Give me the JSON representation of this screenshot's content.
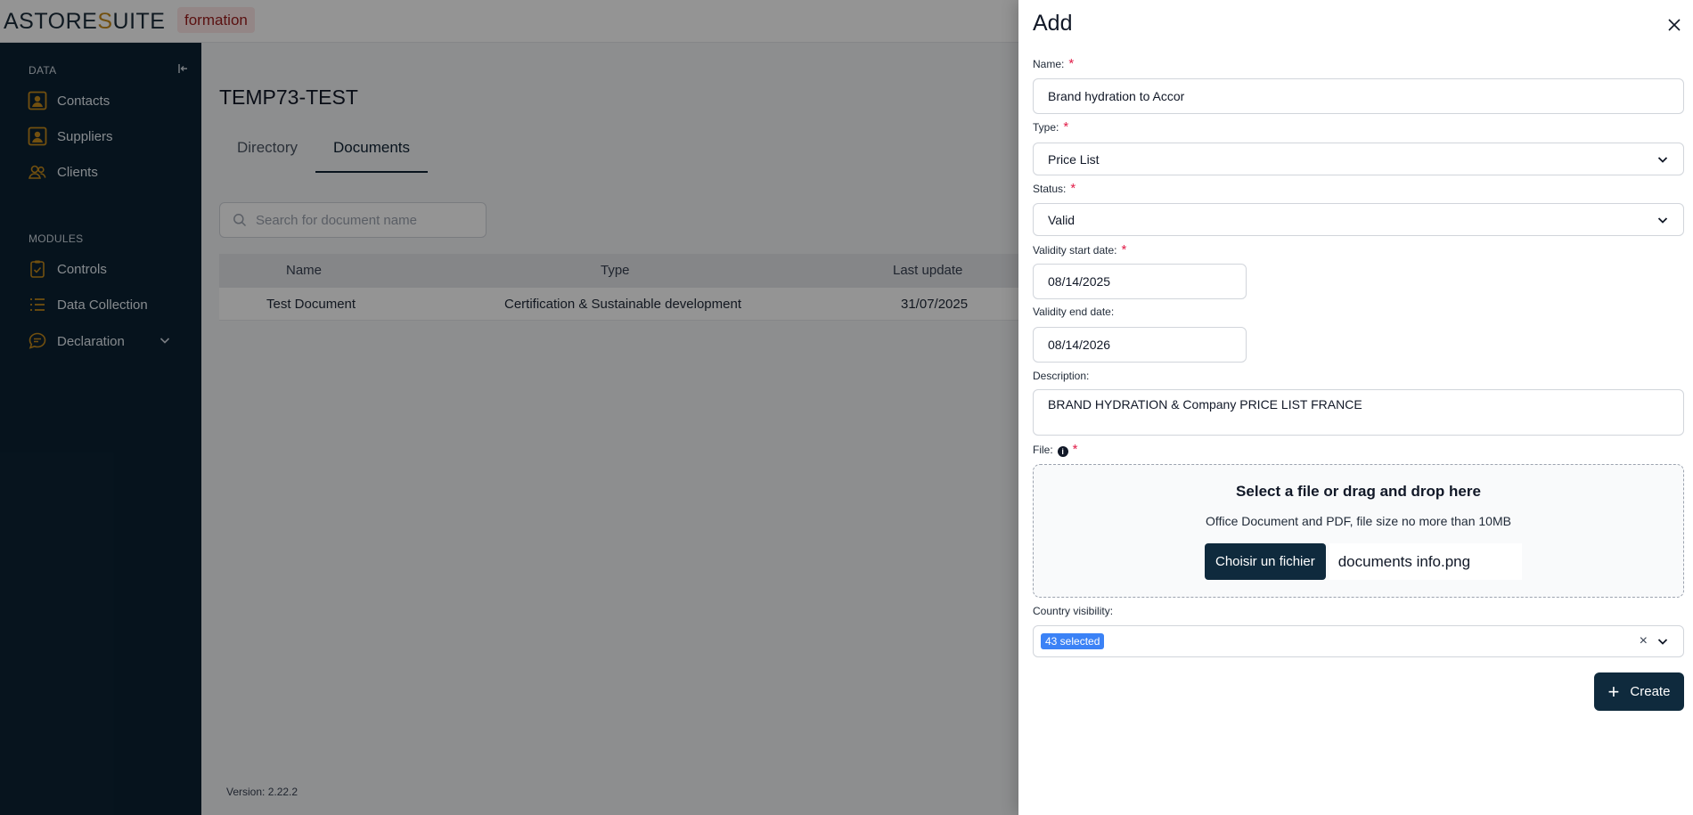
{
  "header": {
    "logo_part1": "ASTORE",
    "logo_accent": "S",
    "logo_part2": "UITE",
    "environment_badge": "formation"
  },
  "sidebar": {
    "section_data": "DATA",
    "section_modules": "MODULES",
    "items": [
      {
        "label": "Contacts",
        "icon": "contact-card-icon"
      },
      {
        "label": "Suppliers",
        "icon": "supplier-card-icon"
      },
      {
        "label": "Clients",
        "icon": "users-icon"
      },
      {
        "label": "Controls",
        "icon": "clipboard-check-icon"
      },
      {
        "label": "Data Collection",
        "icon": "list-icon"
      },
      {
        "label": "Declaration",
        "icon": "chat-bubble-icon"
      }
    ],
    "accent_color": "#c58a1b"
  },
  "main": {
    "page_title": "TEMP73-TEST",
    "tabs": [
      {
        "label": "Directory",
        "active": false
      },
      {
        "label": "Documents",
        "active": true
      }
    ],
    "search_placeholder": "Search for document name",
    "table": {
      "columns": [
        "Name",
        "Type",
        "Last update"
      ],
      "rows": [
        {
          "name": "Test Document",
          "type": "Certification & Sustainable development",
          "last_update": "31/07/2025"
        }
      ]
    },
    "version": "Version: 2.22.2"
  },
  "drawer": {
    "title": "Add",
    "required_mark": "*",
    "name_label": "Name:",
    "name_value": "Brand hydration to Accor",
    "type_label": "Type:",
    "type_value": "Price List",
    "status_label": "Status:",
    "status_value": "Valid",
    "start_label": "Validity start date:",
    "start_value": "08/14/2025",
    "end_label": "Validity end date:",
    "end_value": "08/14/2026",
    "description_label": "Description:",
    "description_value": "BRAND HYDRATION & Company PRICE LIST FRANCE",
    "file_label": "File:",
    "dropzone_title": "Select a file or drag and drop here",
    "dropzone_subtitle": "Office Document and PDF, file size no more than 10MB",
    "choose_file_label": "Choisir un fichier",
    "file_name": "documents info.png",
    "country_label": "Country visibility:",
    "country_selected": "43 selected",
    "create_label": "Create",
    "primary_color": "#0f2a3d"
  }
}
